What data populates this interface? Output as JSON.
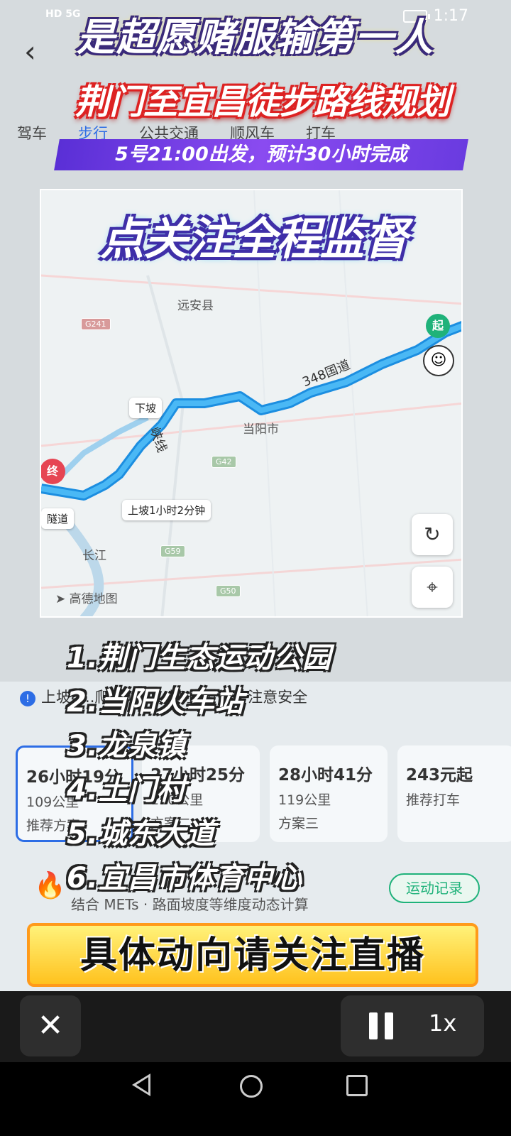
{
  "status": {
    "left": "HD 5G",
    "time": "1:17"
  },
  "banners": {
    "top_title": "是超愿赌服输第一人",
    "route_title": "荆门至宜昌徒步路线规划",
    "depart": "5号21:00出发，预计30小时完成",
    "follow": "点关注全程监督",
    "bottom": "具体动向请关注直播"
  },
  "mode_tabs": [
    "驾车",
    "步行",
    "公共交通",
    "顺风车",
    "打车"
  ],
  "map": {
    "labels": {
      "yuanan": "远安县",
      "dangyang": "当阳市",
      "xiapo": "下坡",
      "shangpo": "上坡1小时2分钟",
      "tunnel": "隧道",
      "road348": "348国道",
      "xiaxian": "峡线",
      "changjiang": "长江",
      "logo": "高德地图"
    },
    "badges": [
      "G241",
      "G42",
      "G59",
      "G50"
    ],
    "start": "起",
    "end": "终"
  },
  "stops": [
    "1.荆门生态运动公园",
    "2.当阳火车站",
    "3.龙泉镇",
    "4.土门村",
    "5.城东大道",
    "6.宜昌市体育中心"
  ],
  "notice": {
    "text": "上坡4...爬坡时间1小时2分钟，注意安全"
  },
  "route_cards": [
    {
      "time": "26小时19分",
      "distance": "109公里",
      "plan": "推荐方案"
    },
    {
      "time": "27小时25分",
      "distance": "110公里",
      "plan": "方案二"
    },
    {
      "time": "28小时41分",
      "distance": "119公里",
      "plan": "方案三"
    },
    {
      "time": "243元起",
      "distance": "",
      "plan": "推荐打车"
    }
  ],
  "sport": {
    "record": "运动记录",
    "mets": "结合 METs · 路面坡度等维度动态计算"
  },
  "player": {
    "speed": "1x"
  }
}
